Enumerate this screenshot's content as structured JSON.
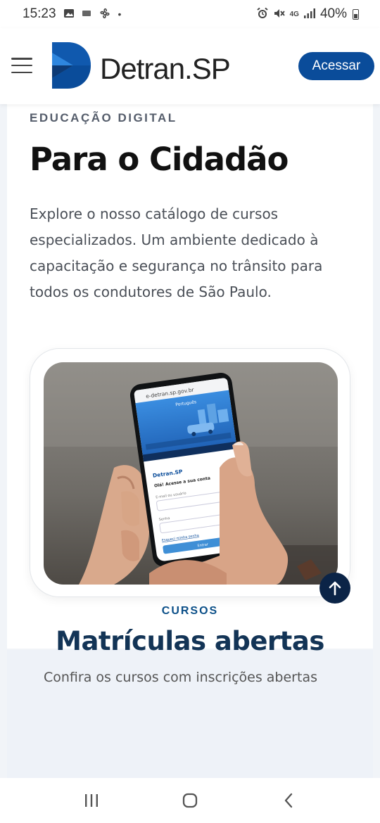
{
  "status_bar": {
    "time": "15:23",
    "left_icons": [
      "image-icon",
      "sim-icon",
      "fan-icon",
      "dot-icon"
    ],
    "right_icons": [
      "alarm-icon",
      "mute-icon",
      "4g-icon",
      "signal-icon",
      "battery-icon"
    ],
    "network": "4G",
    "battery": "40%"
  },
  "header": {
    "logo_text": "Detran.SP",
    "menu_icon": "hamburger-icon",
    "login_button": "Acessar",
    "brand_color": "#0a4c9a"
  },
  "hero": {
    "eyebrow": "EDUCAÇÃO DIGITAL",
    "title": "Para o Cidadão",
    "description": "Explore o nosso catálogo de cursos especializados. Um ambiente dedicado à capacitação e segurança no trânsito para todos os condutores de São Paulo."
  },
  "phone_mockup": {
    "url": "e-detran.sp.gov.br",
    "language": "Português",
    "logo": "Detran.SP",
    "heading": "Olá! Acesse a sua conta",
    "field_user": "E-mail ou usuário",
    "field_password": "Senha",
    "forgot": "Esqueci minha senha",
    "submit": "Entrar"
  },
  "courses_section": {
    "eyebrow": "CURSOS",
    "title": "Matrículas abertas",
    "partial_text": "Confira os cursos com inscrições abertas"
  },
  "scroll_top_button": "arrow-up-icon",
  "nav_bar": {
    "icons": [
      "recent-apps-icon",
      "home-icon",
      "back-icon"
    ]
  },
  "colors": {
    "accent": "#0a4c9a",
    "dark_navy": "#0b2447",
    "section_title": "#133456",
    "page_bg": "#f1f4f8"
  }
}
